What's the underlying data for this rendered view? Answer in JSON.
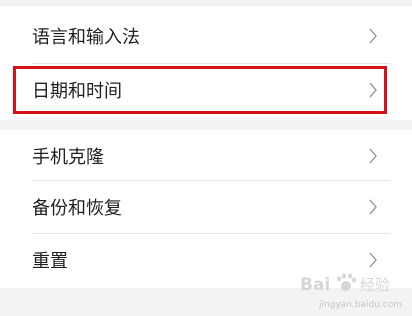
{
  "settings_list": {
    "group1": [
      {
        "label": "语言和输入法"
      },
      {
        "label": "日期和时间"
      }
    ],
    "group2": [
      {
        "label": "手机克隆"
      },
      {
        "label": "备份和恢复"
      },
      {
        "label": "重置"
      }
    ]
  },
  "icons": {
    "row_chevron": "chevron-right-icon"
  },
  "colors": {
    "highlight_border": "#d8101a",
    "section_gap": "#f3f3f3",
    "text": "#1f1f1f",
    "chevron": "#9a9a9a"
  },
  "watermark": {
    "logo_text": "Bai 经验",
    "url_text": "jingyan.baidu.com"
  }
}
